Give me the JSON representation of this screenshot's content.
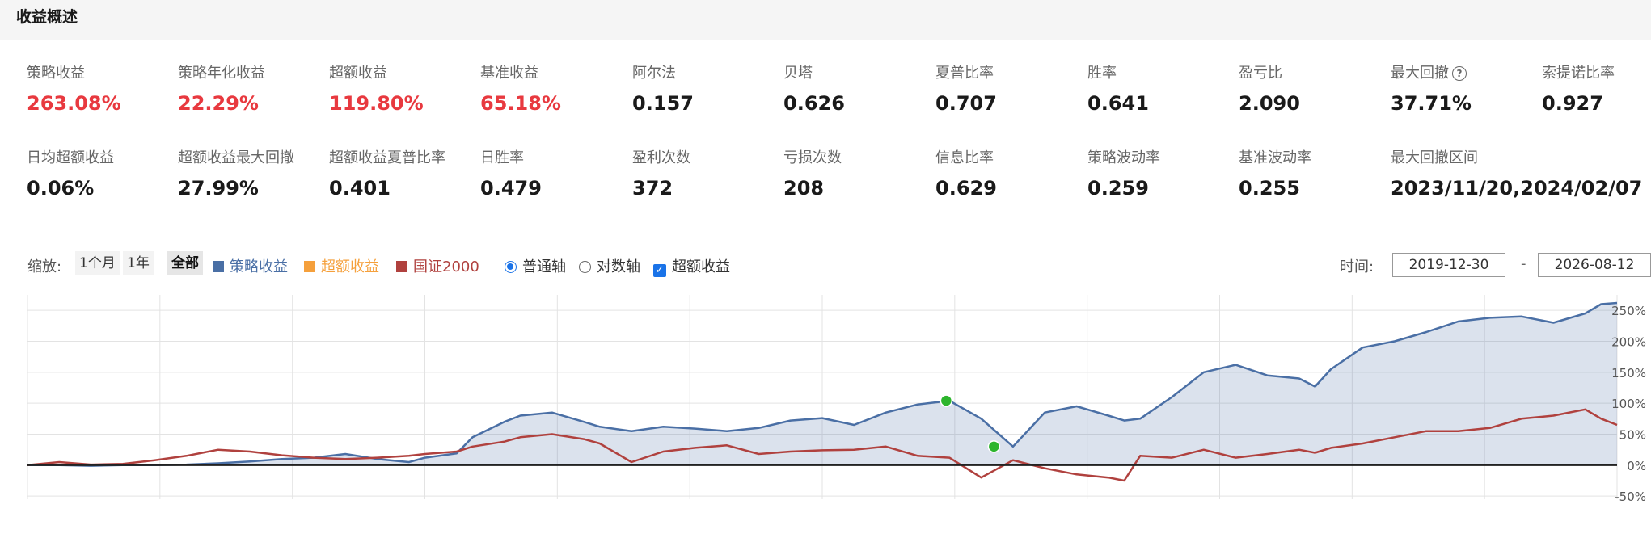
{
  "header": {
    "title": "收益概述"
  },
  "stats_row1": [
    {
      "label": "策略收益",
      "value": "263.08%",
      "red": true
    },
    {
      "label": "策略年化收益",
      "value": "22.29%",
      "red": true
    },
    {
      "label": "超额收益",
      "value": "119.80%",
      "red": true
    },
    {
      "label": "基准收益",
      "value": "65.18%",
      "red": true
    },
    {
      "label": "阿尔法",
      "value": "0.157"
    },
    {
      "label": "贝塔",
      "value": "0.626"
    },
    {
      "label": "夏普比率",
      "value": "0.707"
    },
    {
      "label": "胜率",
      "value": "0.641"
    },
    {
      "label": "盈亏比",
      "value": "2.090"
    },
    {
      "label": "最大回撤",
      "value": "37.71%",
      "help": "?"
    },
    {
      "label": "索提诺比率",
      "value": "0.927"
    }
  ],
  "stats_row2": [
    {
      "label": "日均超额收益",
      "value": "0.06%"
    },
    {
      "label": "超额收益最大回撤",
      "value": "27.99%"
    },
    {
      "label": "超额收益夏普比率",
      "value": "0.401"
    },
    {
      "label": "日胜率",
      "value": "0.479"
    },
    {
      "label": "盈利次数",
      "value": "372"
    },
    {
      "label": "亏损次数",
      "value": "208"
    },
    {
      "label": "信息比率",
      "value": "0.629"
    },
    {
      "label": "策略波动率",
      "value": "0.259"
    },
    {
      "label": "基准波动率",
      "value": "0.255"
    },
    {
      "label": "最大回撤区间",
      "value": "2023/11/20,2024/02/07"
    }
  ],
  "controls": {
    "zoom_label": "缩放:",
    "zoom_1m": "1个月",
    "zoom_1y": "1年",
    "zoom_all": "全部",
    "legend_strategy": "策略收益",
    "legend_excess": "超额收益",
    "legend_benchmark": "国证2000",
    "axis_normal": "普通轴",
    "axis_log": "对数轴",
    "excess_toggle": "超额收益",
    "time_label": "时间:",
    "date_from": "2019-12-30",
    "date_to": "2026-08-12",
    "date_separator": "-"
  },
  "colors": {
    "strategy": "#4a6fa5",
    "excess": "#f5a03c",
    "benchmark": "#b0413e",
    "positive": "#e8393f",
    "marker": "#2db52d",
    "accent": "#1a73e8"
  },
  "chart_data": {
    "type": "line",
    "y_ticks": [
      "-50%",
      "0%",
      "50%",
      "100%",
      "150%",
      "200%",
      "250%"
    ],
    "y_tick_values": [
      -50,
      0,
      50,
      100,
      150,
      200,
      250
    ],
    "ylim": [
      -55,
      275
    ],
    "x_range": [
      "2019-12-30",
      "2026-08-12"
    ],
    "series": [
      {
        "name": "策略收益",
        "color": "#4a6fa5",
        "area": true,
        "x": [
          0,
          0.02,
          0.04,
          0.06,
          0.08,
          0.1,
          0.12,
          0.14,
          0.16,
          0.18,
          0.2,
          0.22,
          0.24,
          0.25,
          0.27,
          0.28,
          0.3,
          0.31,
          0.33,
          0.35,
          0.36,
          0.38,
          0.4,
          0.42,
          0.44,
          0.46,
          0.48,
          0.5,
          0.52,
          0.54,
          0.56,
          0.58,
          0.6,
          0.62,
          0.64,
          0.66,
          0.68,
          0.69,
          0.7,
          0.72,
          0.74,
          0.76,
          0.78,
          0.8,
          0.81,
          0.82,
          0.84,
          0.86,
          0.88,
          0.9,
          0.92,
          0.94,
          0.96,
          0.98,
          0.99,
          1.0
        ],
        "y": [
          0,
          0,
          -1,
          0,
          0,
          1,
          3,
          6,
          10,
          12,
          18,
          10,
          5,
          12,
          19,
          45,
          70,
          80,
          85,
          70,
          62,
          55,
          62,
          59,
          55,
          60,
          72,
          76,
          65,
          85,
          98,
          104,
          75,
          30,
          85,
          95,
          80,
          72,
          75,
          110,
          150,
          162,
          145,
          140,
          127,
          155,
          190,
          200,
          215,
          232,
          238,
          240,
          230,
          245,
          260,
          262
        ]
      },
      {
        "name": "国证2000",
        "color": "#b0413e",
        "x": [
          0,
          0.02,
          0.04,
          0.06,
          0.08,
          0.1,
          0.12,
          0.14,
          0.16,
          0.18,
          0.2,
          0.22,
          0.24,
          0.25,
          0.27,
          0.28,
          0.3,
          0.31,
          0.33,
          0.35,
          0.36,
          0.38,
          0.4,
          0.42,
          0.44,
          0.46,
          0.48,
          0.5,
          0.52,
          0.54,
          0.56,
          0.58,
          0.6,
          0.62,
          0.64,
          0.66,
          0.68,
          0.69,
          0.7,
          0.72,
          0.74,
          0.76,
          0.78,
          0.8,
          0.81,
          0.82,
          0.84,
          0.86,
          0.88,
          0.9,
          0.92,
          0.94,
          0.96,
          0.98,
          0.99,
          1.0
        ],
        "y": [
          0,
          5,
          1,
          2,
          8,
          15,
          25,
          22,
          16,
          12,
          10,
          12,
          15,
          18,
          22,
          30,
          38,
          45,
          50,
          42,
          35,
          5,
          22,
          28,
          32,
          18,
          22,
          24,
          25,
          30,
          15,
          12,
          -20,
          8,
          -5,
          -15,
          -20,
          -25,
          15,
          12,
          25,
          12,
          18,
          25,
          20,
          28,
          35,
          45,
          55,
          55,
          60,
          75,
          80,
          90,
          75,
          65
        ]
      }
    ],
    "markers": [
      {
        "label": "max-drawdown-start",
        "x": 0.578,
        "y": 104
      },
      {
        "label": "max-drawdown-end",
        "x": 0.608,
        "y": 30
      }
    ],
    "grid": true,
    "legend_placement": "top-left"
  }
}
